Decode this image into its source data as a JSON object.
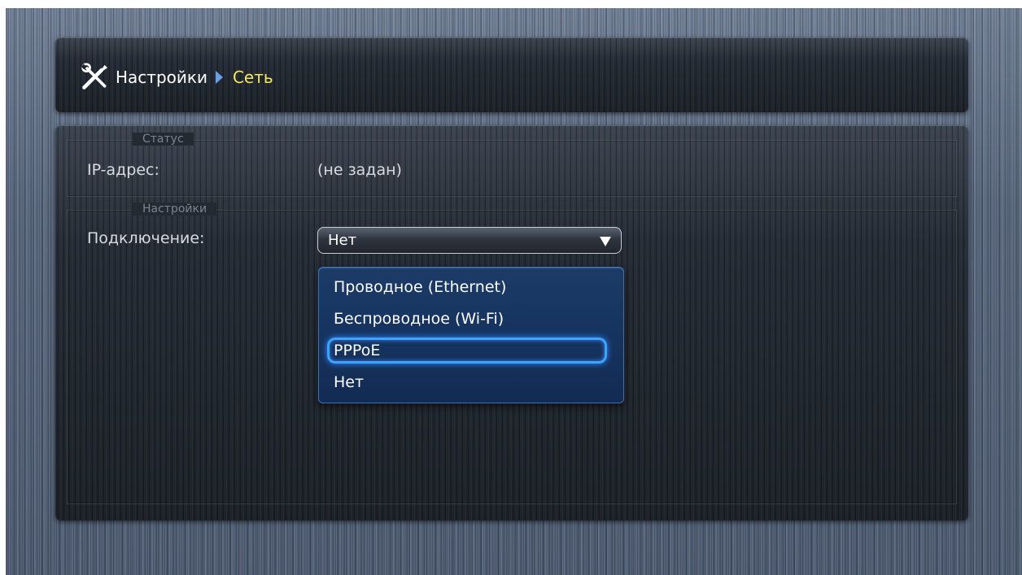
{
  "breadcrumb": {
    "items": [
      "Настройки",
      "Сеть"
    ]
  },
  "status_group": {
    "legend": "Статус",
    "ip_label": "IP-адрес:",
    "ip_value": "(не задан)"
  },
  "settings_group": {
    "legend": "Настройки",
    "connection_label": "Подключение:",
    "connection_value": "Нет"
  },
  "dropdown": {
    "options": [
      "Проводное (Ethernet)",
      "Беспроводное (Wi-Fi)",
      "PPPoE",
      "Нет"
    ],
    "focused": "PPPoE"
  },
  "icons": {
    "header": "tools-icon",
    "breadcrumb_separator": "chevron-right-icon",
    "select": "triangle-down-icon"
  },
  "colors": {
    "current_crumb": "#f2e85a",
    "focus_ring": "#3ea2ff",
    "dropdown_bg": "#163360"
  }
}
